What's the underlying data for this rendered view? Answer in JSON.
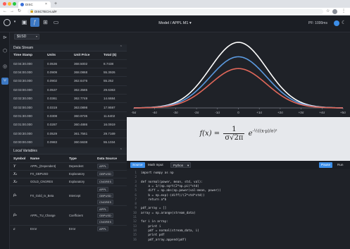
{
  "browser": {
    "tab_title": "DISC",
    "url": "DISCTECH.ai/#",
    "lock_icon": "lock-icon",
    "new_tab_icon": "plus-icon"
  },
  "header": {
    "title": "Model / APPL M1",
    "ppf": "PF: 1000ms",
    "dropdown_chevron": "▾"
  },
  "ticker": {
    "value": "$USD"
  },
  "data_stream": {
    "title": "Data Stream",
    "collapse": "⌃",
    "columns": [
      "Time Stamp",
      "Units",
      "Unit Price",
      "Total ($)"
    ],
    "rows": [
      [
        "02:04:30.000",
        "0.0536",
        "368.5002",
        "8.7438"
      ],
      [
        "02:04:00.000",
        "0.0909",
        "368.0868",
        "55.3926"
      ],
      [
        "02:03:30.000",
        "0.0902",
        "362.6476",
        "55.252"
      ],
      [
        "02:03:00.000",
        "0.0537",
        "362.3585",
        "29.6363"
      ],
      [
        "02:02:30.000",
        "0.0361",
        "362.7749",
        "14.6684"
      ],
      [
        "02:02:00.000",
        "0.0319",
        "363.0898",
        "17.9597"
      ],
      [
        "02:01:30.000",
        "0.0308",
        "360.9735",
        "11.6402"
      ],
      [
        "02:01:00.000",
        "0.0287",
        "360.4886",
        "16.0919"
      ],
      [
        "02:00:30.000",
        "0.0529",
        "361.7561",
        "29.7169"
      ],
      [
        "02:00:00.000",
        "0.0983",
        "360.5638",
        "55.1034"
      ]
    ]
  },
  "local_variables": {
    "title": "Local Variables",
    "collapse": "⌃",
    "columns": [
      "Symbol",
      "Name",
      "Type",
      "Data Source"
    ],
    "rows": [
      {
        "symbol": "Y",
        "name": "APPL_(Dependent)",
        "type": "Dependent",
        "sources": [
          "APPL"
        ]
      },
      {
        "symbol": "X₁",
        "name": "FX_GBPUSD",
        "type": "Explanatory",
        "sources": [
          "GBPUSD"
        ]
      },
      {
        "symbol": "X₂",
        "name": "GOLD_CNGRES",
        "type": "Explanatory",
        "sources": [
          "CNGRES"
        ]
      },
      {
        "symbol": "β₁",
        "name": "FX_Gold_rx_Beta",
        "type": "Intercept",
        "sources": [
          "APPL",
          "GBPUSD",
          "CNGRES"
        ]
      },
      {
        "symbol": "β₂",
        "name": "APPL_TU_Change",
        "type": "Coefficient",
        "sources": [
          "APPL",
          "GBPUSD",
          "CNGRES"
        ]
      },
      {
        "symbol": "ε",
        "name": "Error",
        "type": "Error",
        "sources": [
          "APPL"
        ]
      }
    ]
  },
  "chart_data": {
    "type": "line",
    "title": "",
    "xlabel": "",
    "ylabel": "",
    "x_ticks": [
      "-5σ",
      "-4σ",
      "-3σ",
      "-2σ",
      "-1σ",
      "0",
      "+1σ",
      "+2σ",
      "+3σ",
      "+4σ",
      "+5σ"
    ],
    "xlim": [
      -5,
      5
    ],
    "ylim": [
      0,
      1
    ],
    "grid": false,
    "series": [
      {
        "color": "#ffffff",
        "sigma": 1.35,
        "peak": 1.0
      },
      {
        "color": "#5b9ae0",
        "sigma": 1.35,
        "peak": 0.78
      },
      {
        "color": "#e0675a",
        "sigma": 1.35,
        "peak": 0.6
      }
    ]
  },
  "formula": {
    "lhs": "f(x) =",
    "num": "1",
    "den": "σ√2π",
    "exp_base": "e",
    "exponent": "-½((x-μ)/σ)²"
  },
  "editor": {
    "tabs": [
      "Source",
      "Math Input",
      "Python"
    ],
    "active_tab": "Source",
    "pause_label": "Pause",
    "run_label": "Run",
    "lines": [
      "import numpy as np",
      "",
      "def normal(power, mean, std, val):",
      "    a = 1/(np.sqrt(2*np.pi)*std)",
      "    diff = np.abs(np.power(val-mean, power))",
      "    b = np.exp(-(diff)/(2*std*std))",
      "    return a*b",
      "",
      "pdf_array = []",
      "array = np.arange(stream_data)",
      "",
      "for i in array:",
      "    print i",
      "    pdf = normal(stream_data, i)",
      "    print pdf",
      "    pdf_array.append(pdf)"
    ]
  }
}
